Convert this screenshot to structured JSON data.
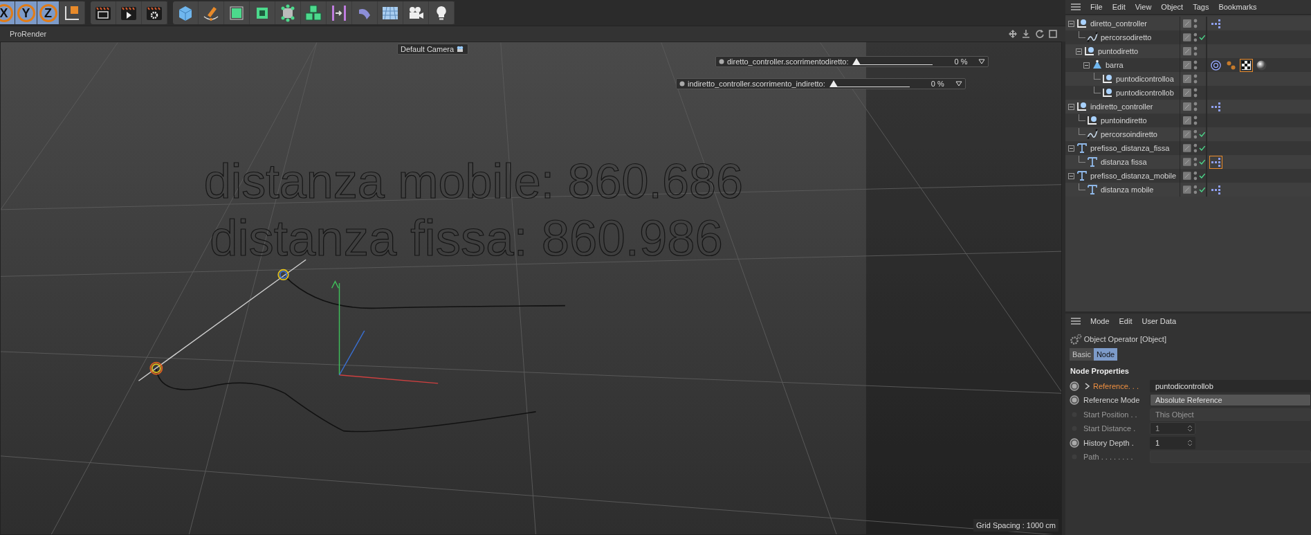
{
  "toolbar": {
    "axis_toggles": [
      {
        "label": "X",
        "selected": true
      },
      {
        "label": "Y",
        "selected": true
      },
      {
        "label": "Z",
        "selected": true
      }
    ]
  },
  "viewport": {
    "menu": [
      "ProRender"
    ],
    "camera_label": "Default Camera",
    "hud_sliders": [
      {
        "label": "diretto_controller.scorrimentodiretto:",
        "level": 0,
        "reading": "0 %"
      },
      {
        "label": "indiretto_controller.scorrimento_indiretto:",
        "level": 0,
        "reading": "0 %"
      }
    ],
    "scene_texts": [
      "distanza mobile: 860.686",
      "distanza fissa: 860.986"
    ],
    "grid_spacing": "Grid Spacing : 1000 cm"
  },
  "object_manager": {
    "menu": [
      "File",
      "Edit",
      "View",
      "Object",
      "Tags",
      "Bookmarks"
    ],
    "objects": [
      {
        "name": "diretto_controller",
        "kind": "null",
        "checked": false,
        "expanded": true,
        "tags": [
          {
            "kind": "xpresso",
            "selected": false
          }
        ],
        "children": [
          {
            "name": "percorsodiretto",
            "kind": "spline",
            "checked": true
          },
          {
            "name": "puntodiretto",
            "kind": "null",
            "checked": false,
            "expanded": true,
            "children": [
              {
                "name": "barra",
                "kind": "cone",
                "checked": false,
                "expanded": true,
                "tags": [
                  {
                    "kind": "target",
                    "selected": false
                  },
                  {
                    "kind": "dots",
                    "selected": false
                  },
                  {
                    "kind": "checker",
                    "selected": true
                  },
                  {
                    "kind": "material",
                    "selected": false
                  }
                ],
                "children": [
                  {
                    "name": "puntodicontrolloa",
                    "kind": "null",
                    "checked": false
                  },
                  {
                    "name": "puntodicontrollob",
                    "kind": "null",
                    "checked": false
                  }
                ]
              }
            ]
          }
        ]
      },
      {
        "name": "indiretto_controller",
        "kind": "null",
        "checked": false,
        "expanded": true,
        "tags": [
          {
            "kind": "xpresso",
            "selected": false
          }
        ],
        "children": [
          {
            "name": "puntoindiretto",
            "kind": "null",
            "checked": false
          },
          {
            "name": "percorsoindiretto",
            "kind": "spline",
            "checked": true
          }
        ]
      },
      {
        "name": "prefisso_distanza_fissa",
        "kind": "text",
        "checked": true,
        "expanded": true,
        "children": [
          {
            "name": "distanza fissa",
            "kind": "text",
            "checked": true,
            "tags": [
              {
                "kind": "xpresso",
                "selected": true
              }
            ]
          }
        ]
      },
      {
        "name": "prefisso_distanza_mobile",
        "kind": "text",
        "checked": true,
        "expanded": true,
        "children": [
          {
            "name": "distanza mobile",
            "kind": "text",
            "checked": true,
            "tags": [
              {
                "kind": "xpresso",
                "selected": false
              }
            ]
          }
        ]
      }
    ]
  },
  "attribute_manager": {
    "menu": [
      "Mode",
      "Edit",
      "User Data"
    ],
    "title": "Object Operator [Object]",
    "tabs": [
      {
        "label": "Basic",
        "selected": false
      },
      {
        "label": "Node",
        "selected": true
      }
    ],
    "section": "Node Properties",
    "properties": [
      {
        "label": "Reference. . .",
        "value": "puntodicontrollob",
        "kind": "link",
        "disabled": false,
        "highlight": true,
        "expanded": false
      },
      {
        "label": "Reference Mode",
        "value": "Absolute Reference",
        "kind": "dropdown",
        "disabled": false,
        "highlight": false
      },
      {
        "label": "Start Position . .",
        "value": "This Object",
        "kind": "dropdown",
        "disabled": true,
        "highlight": false
      },
      {
        "label": "Start Distance  .",
        "value": "1",
        "kind": "number",
        "disabled": true,
        "highlight": false
      },
      {
        "label": "History Depth  .",
        "value": "1",
        "kind": "number",
        "disabled": false,
        "highlight": false
      },
      {
        "label": "Path . . . . . . . .",
        "kind": "text",
        "disabled": true,
        "highlight": false
      }
    ]
  }
}
